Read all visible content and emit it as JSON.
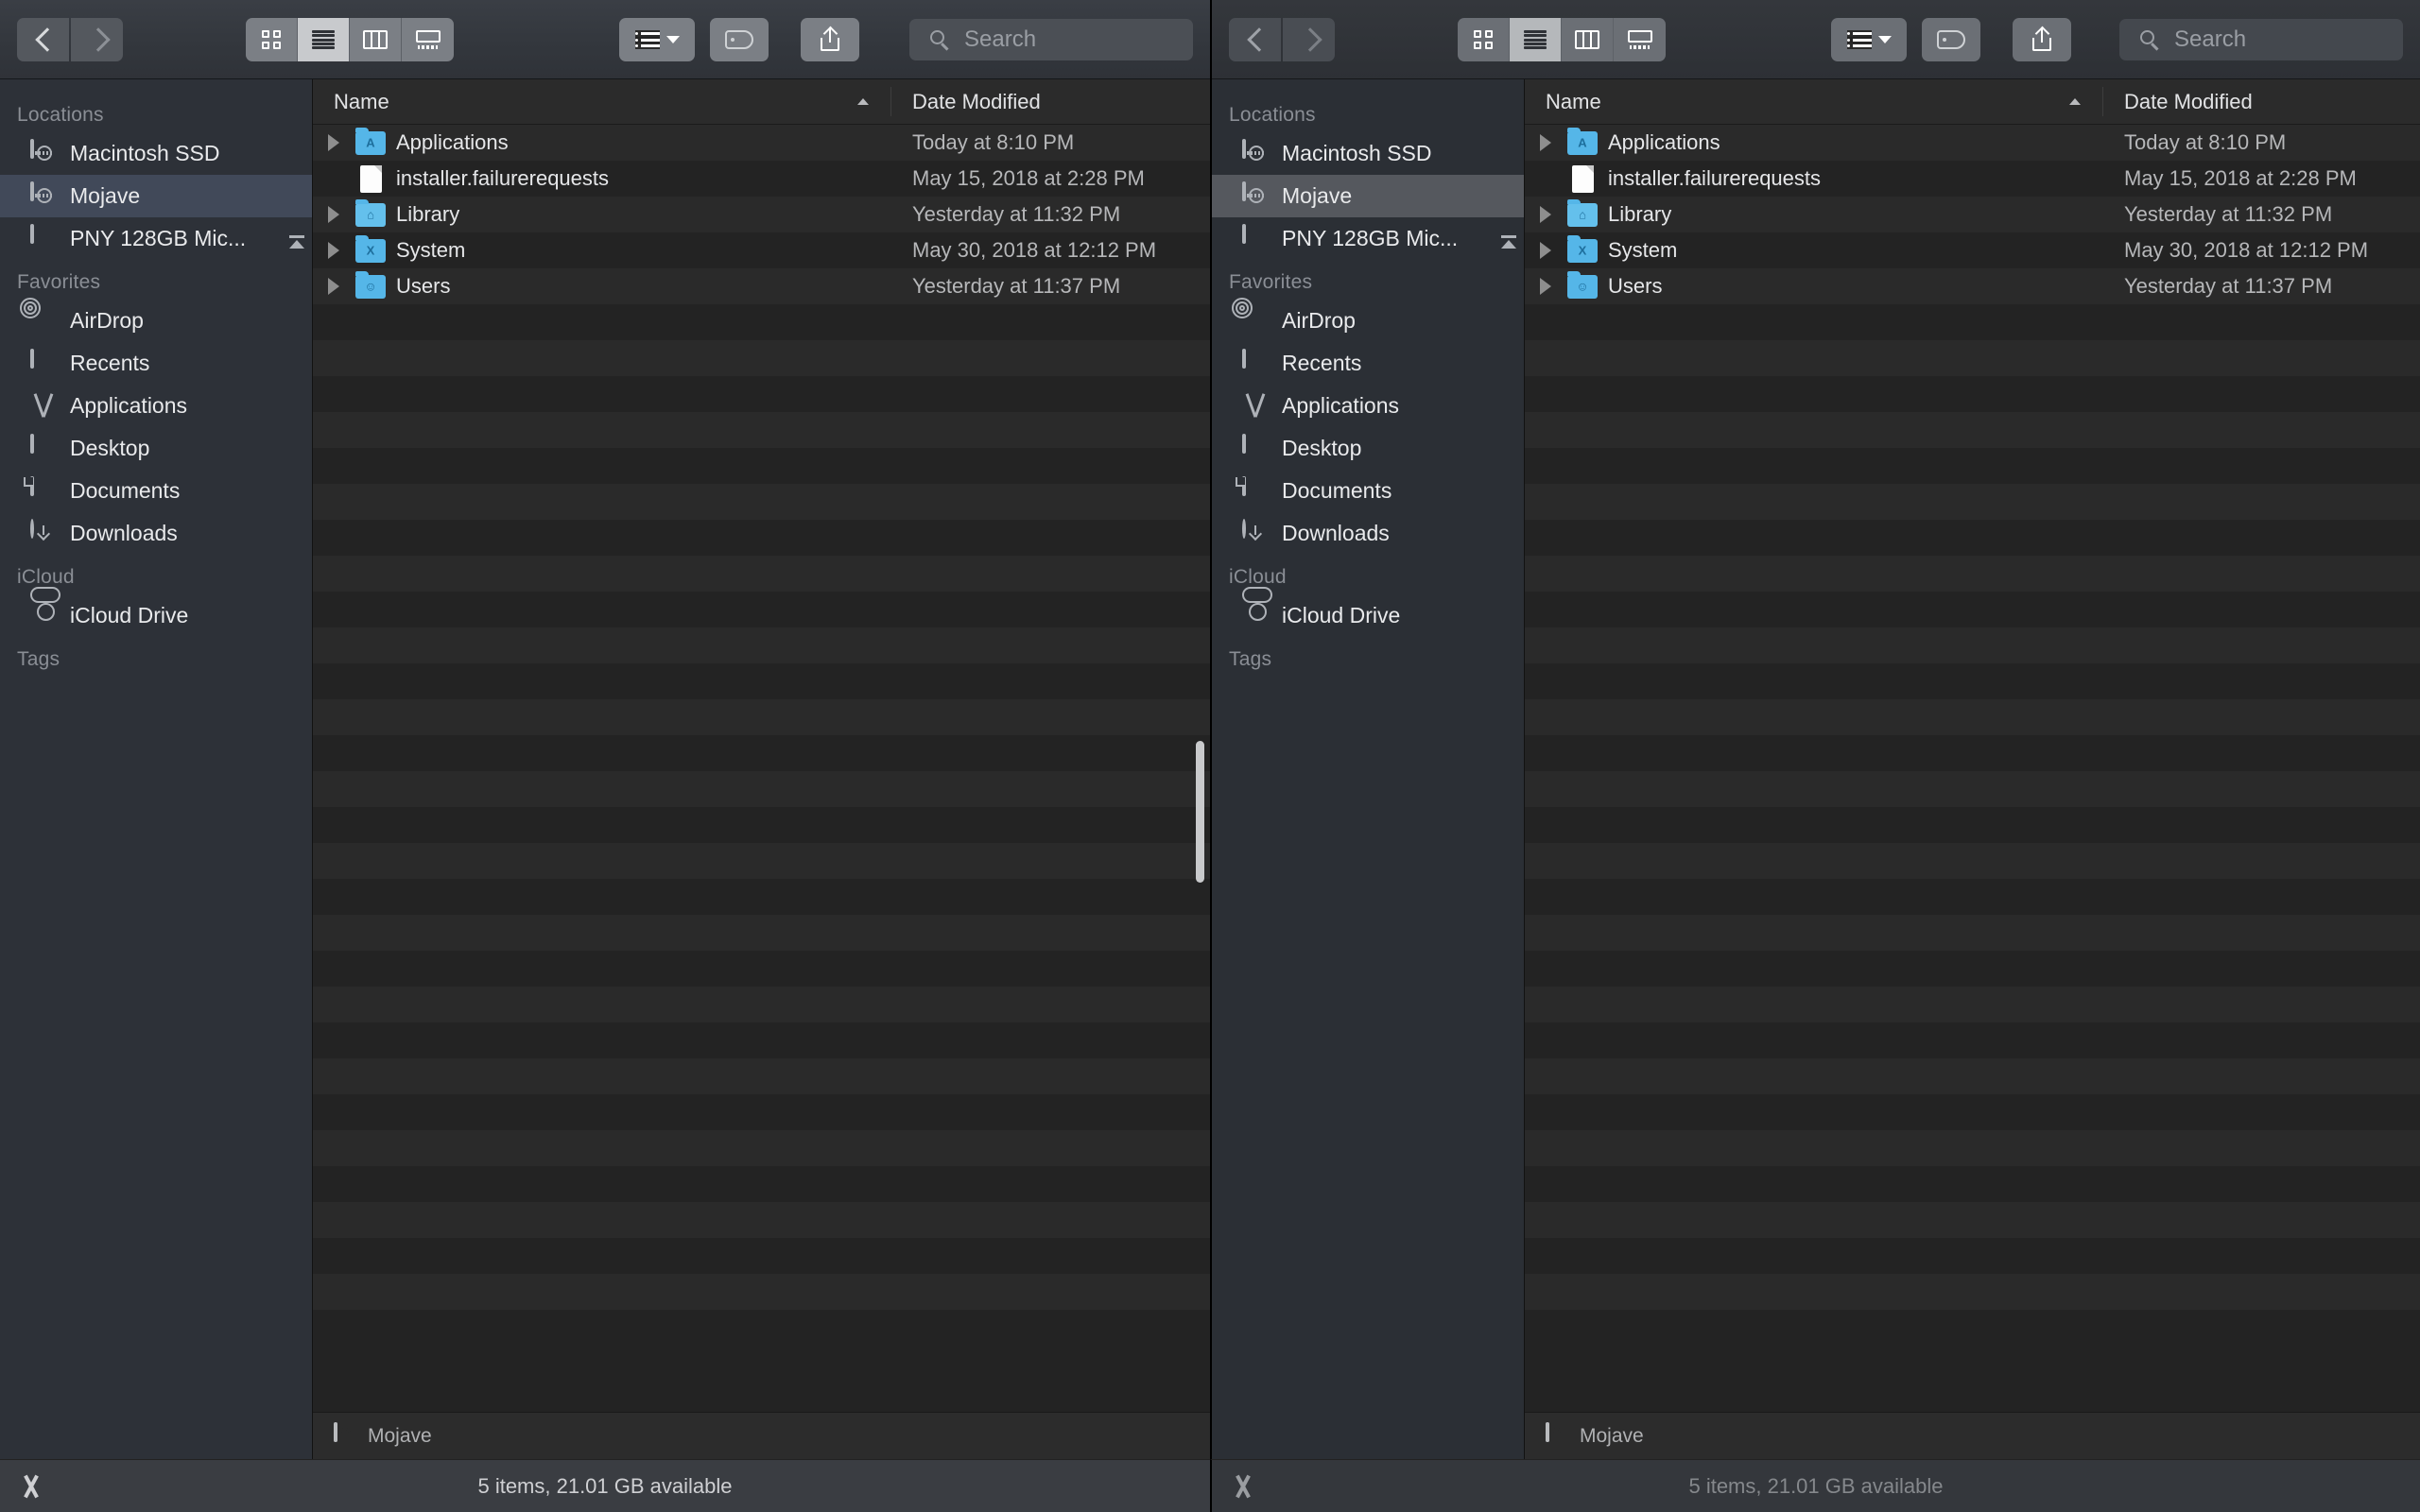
{
  "windows": [
    {
      "id": "left",
      "focused": true,
      "toolbar": {
        "back_label": "Back",
        "forward_label": "Forward",
        "view_buttons": [
          {
            "name": "icon-view",
            "label": "Icon View",
            "active": false
          },
          {
            "name": "list-view",
            "label": "List View",
            "active": true
          },
          {
            "name": "column-view",
            "label": "Column View",
            "active": false
          },
          {
            "name": "gallery-view",
            "label": "Gallery View",
            "active": false
          }
        ],
        "arrange_label": "Arrange",
        "tag_label": "Edit Tags",
        "share_label": "Share",
        "search_placeholder": "Search"
      },
      "sidebar": {
        "sections": [
          {
            "title": "Locations",
            "items": [
              {
                "label": "Macintosh SSD",
                "icon": "hard-drive-icon",
                "selected": false,
                "eject": false
              },
              {
                "label": "Mojave",
                "icon": "hard-drive-icon",
                "selected": true,
                "eject": false
              },
              {
                "label": "PNY 128GB Mic...",
                "icon": "external-drive-icon",
                "selected": false,
                "eject": true
              }
            ]
          },
          {
            "title": "Favorites",
            "items": [
              {
                "label": "AirDrop",
                "icon": "airdrop-icon",
                "selected": false,
                "eject": false
              },
              {
                "label": "Recents",
                "icon": "recents-icon",
                "selected": false,
                "eject": false
              },
              {
                "label": "Applications",
                "icon": "applications-icon",
                "selected": false,
                "eject": false
              },
              {
                "label": "Desktop",
                "icon": "desktop-icon",
                "selected": false,
                "eject": false
              },
              {
                "label": "Documents",
                "icon": "documents-icon",
                "selected": false,
                "eject": false
              },
              {
                "label": "Downloads",
                "icon": "downloads-icon",
                "selected": false,
                "eject": false
              }
            ]
          },
          {
            "title": "iCloud",
            "items": [
              {
                "label": "iCloud Drive",
                "icon": "cloud-icon",
                "selected": false,
                "eject": false
              }
            ]
          },
          {
            "title": "Tags",
            "items": []
          }
        ]
      },
      "file_list": {
        "columns": [
          {
            "label": "Name",
            "sorted": true
          },
          {
            "label": "Date Modified",
            "sorted": false
          }
        ],
        "rows": [
          {
            "name": "Applications",
            "date": "Today at 8:10 PM",
            "icon": "folder-applications-icon",
            "glyph": "A",
            "expandable": true
          },
          {
            "name": "installer.failurerequests",
            "date": "May 15, 2018 at 2:28 PM",
            "icon": "document-file-icon",
            "glyph": "",
            "expandable": false
          },
          {
            "name": "Library",
            "date": "Yesterday at 11:32 PM",
            "icon": "folder-library-icon",
            "glyph": "⌂",
            "expandable": true
          },
          {
            "name": "System",
            "date": "May 30, 2018 at 12:12 PM",
            "icon": "folder-system-icon",
            "glyph": "X",
            "expandable": true
          },
          {
            "name": "Users",
            "date": "Yesterday at 11:37 PM",
            "icon": "folder-users-icon",
            "glyph": "☺",
            "expandable": true
          }
        ]
      },
      "path_bar": {
        "label": "Mojave",
        "icon": "hard-drive-icon"
      },
      "status_bar": {
        "text": "5 items, 21.01 GB available"
      }
    },
    {
      "id": "right",
      "focused": false,
      "toolbar": {
        "back_label": "Back",
        "forward_label": "Forward",
        "view_buttons": [
          {
            "name": "icon-view",
            "label": "Icon View",
            "active": false
          },
          {
            "name": "list-view",
            "label": "List View",
            "active": true
          },
          {
            "name": "column-view",
            "label": "Column View",
            "active": false
          },
          {
            "name": "gallery-view",
            "label": "Gallery View",
            "active": false
          }
        ],
        "arrange_label": "Arrange",
        "tag_label": "Edit Tags",
        "share_label": "Share",
        "search_placeholder": "Search"
      },
      "sidebar": {
        "sections": [
          {
            "title": "Locations",
            "items": [
              {
                "label": "Macintosh SSD",
                "icon": "hard-drive-icon",
                "selected": false,
                "eject": false
              },
              {
                "label": "Mojave",
                "icon": "hard-drive-icon",
                "selected": true,
                "eject": false
              },
              {
                "label": "PNY 128GB Mic...",
                "icon": "external-drive-icon",
                "selected": false,
                "eject": true
              }
            ]
          },
          {
            "title": "Favorites",
            "items": [
              {
                "label": "AirDrop",
                "icon": "airdrop-icon",
                "selected": false,
                "eject": false
              },
              {
                "label": "Recents",
                "icon": "recents-icon",
                "selected": false,
                "eject": false
              },
              {
                "label": "Applications",
                "icon": "applications-icon",
                "selected": false,
                "eject": false
              },
              {
                "label": "Desktop",
                "icon": "desktop-icon",
                "selected": false,
                "eject": false
              },
              {
                "label": "Documents",
                "icon": "documents-icon",
                "selected": false,
                "eject": false
              },
              {
                "label": "Downloads",
                "icon": "downloads-icon",
                "selected": false,
                "eject": false
              }
            ]
          },
          {
            "title": "iCloud",
            "items": [
              {
                "label": "iCloud Drive",
                "icon": "cloud-icon",
                "selected": false,
                "eject": false
              }
            ]
          },
          {
            "title": "Tags",
            "items": []
          }
        ]
      },
      "file_list": {
        "columns": [
          {
            "label": "Name",
            "sorted": true
          },
          {
            "label": "Date Modified",
            "sorted": false
          }
        ],
        "rows": [
          {
            "name": "Applications",
            "date": "Today at 8:10 PM",
            "icon": "folder-applications-icon",
            "glyph": "A",
            "expandable": true
          },
          {
            "name": "installer.failurerequests",
            "date": "May 15, 2018 at 2:28 PM",
            "icon": "document-file-icon",
            "glyph": "",
            "expandable": false
          },
          {
            "name": "Library",
            "date": "Yesterday at 11:32 PM",
            "icon": "folder-library-icon",
            "glyph": "⌂",
            "expandable": true
          },
          {
            "name": "System",
            "date": "May 30, 2018 at 12:12 PM",
            "icon": "folder-system-icon",
            "glyph": "X",
            "expandable": true
          },
          {
            "name": "Users",
            "date": "Yesterday at 11:37 PM",
            "icon": "folder-users-icon",
            "glyph": "☺",
            "expandable": true
          }
        ]
      },
      "path_bar": {
        "label": "Mojave",
        "icon": "hard-drive-icon"
      },
      "status_bar": {
        "text": "5 items, 21.01 GB available"
      }
    }
  ],
  "colors": {
    "selection_active": "#414959",
    "selection_inactive": "#55585e",
    "folder_blue": "#55b6e8",
    "toolbar_bg": "#33373d",
    "sidebar_bg": "#2d3138",
    "pane_bg": "#232323"
  }
}
